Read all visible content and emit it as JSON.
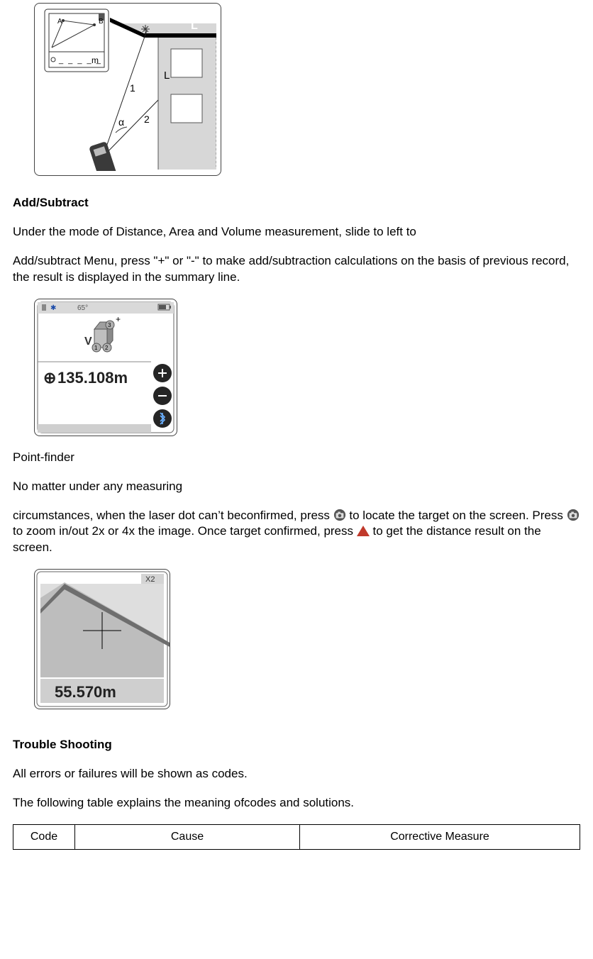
{
  "figure1": {
    "mini_unit": "m",
    "mini_A": "A",
    "mini_B": "B",
    "label_L": "L",
    "label_L2": "L",
    "label_1": "1",
    "label_2": "2",
    "label_alpha": "α"
  },
  "add_subtract": {
    "heading": "Add/Subtract",
    "p1": "Under the mode of Distance, Area and Volume measurement, slide to left to",
    "p2": "Add/subtract Menu, press \"+\" or \"-\" to make add/subtraction calculations on the basis of previous record, the result is displayed in the summary line."
  },
  "figure2": {
    "degrees": "65°",
    "v_label": "V",
    "idx1": "1",
    "idx2": "2",
    "idx3": "3",
    "plus_sup": "+",
    "readout": "135.108m",
    "readout_bullet": "⊕"
  },
  "point_finder": {
    "heading": "Point-finder",
    "p1": "No matter under any measuring",
    "p2a": "circumstances, when the laser dot can’t beconfirmed, press ",
    "p2b": " to locate the target on the screen. Press ",
    "p2c": " to zoom in/out 2x or 4x the image. Once target confirmed, press ",
    "p2d": " to get the distance result on the screen."
  },
  "figure3": {
    "zoom": "X2",
    "readout": "55.570m"
  },
  "trouble": {
    "heading": "Trouble Shooting",
    "p1": "All errors or failures will be shown as codes.",
    "p2": "The following table explains the meaning ofcodes and solutions."
  },
  "table": {
    "h_code": "Code",
    "h_cause": "Cause",
    "h_measure": "Corrective Measure"
  }
}
